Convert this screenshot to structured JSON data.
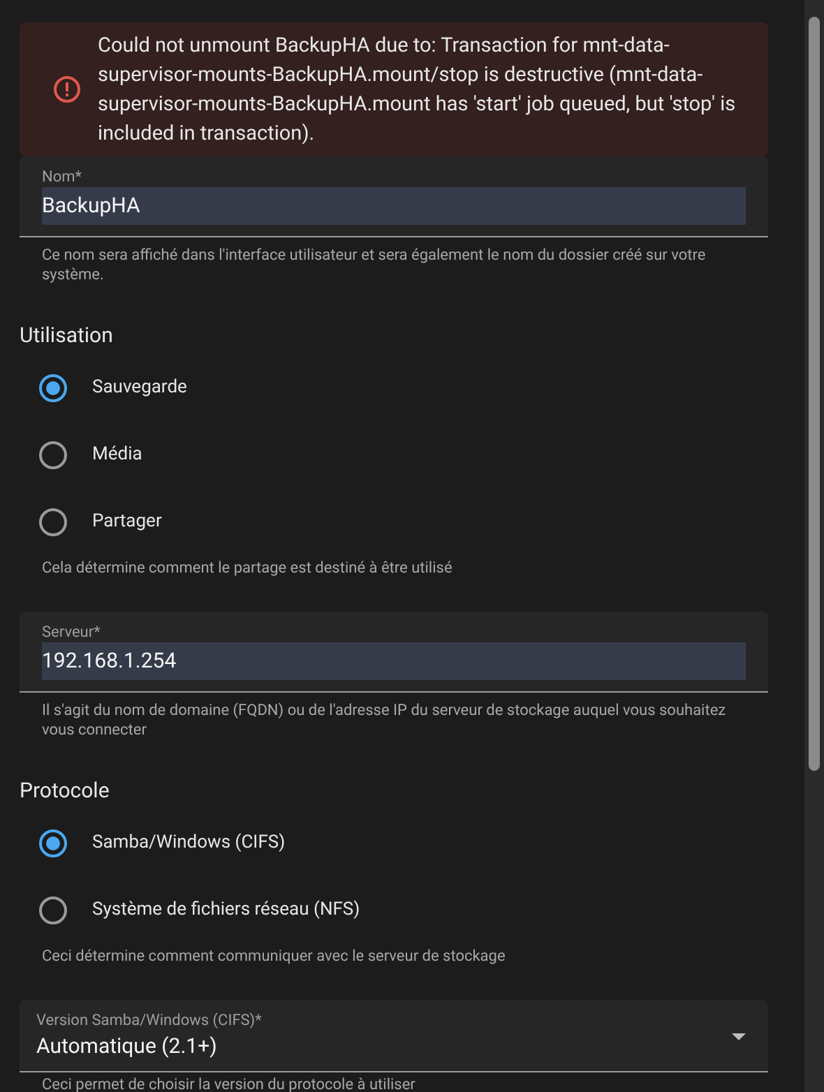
{
  "alert": {
    "text": "Could not unmount BackupHA due to: Transaction for mnt-data-supervisor-mounts-BackupHA.mount/stop is destructive (mnt-data-supervisor-mounts-BackupHA.mount has 'start' job queued, but 'stop' is included in transaction)."
  },
  "name_field": {
    "label": "Nom*",
    "value": "BackupHA",
    "helper": "Ce nom sera affiché dans l'interface utilisateur et sera également le nom du dossier créé sur votre système."
  },
  "usage": {
    "title": "Utilisation",
    "options": [
      {
        "label": "Sauvegarde",
        "selected": true
      },
      {
        "label": "Média",
        "selected": false
      },
      {
        "label": "Partager",
        "selected": false
      }
    ],
    "helper": "Cela détermine comment le partage est destiné à être utilisé"
  },
  "server_field": {
    "label": "Serveur*",
    "value": "192.168.1.254",
    "helper": "Il s'agit du nom de domaine (FQDN) ou de l'adresse IP du serveur de stockage auquel vous souhaitez vous connecter"
  },
  "protocol": {
    "title": "Protocole",
    "options": [
      {
        "label": "Samba/Windows (CIFS)",
        "selected": true
      },
      {
        "label": "Système de fichiers réseau (NFS)",
        "selected": false
      }
    ],
    "helper": "Ceci détermine comment communiquer avec le serveur de stockage"
  },
  "version_select": {
    "label": "Version Samba/Windows (CIFS)*",
    "value": "Automatique (2.1+)",
    "helper": "Ceci permet de choisir la version du protocole à utiliser"
  }
}
